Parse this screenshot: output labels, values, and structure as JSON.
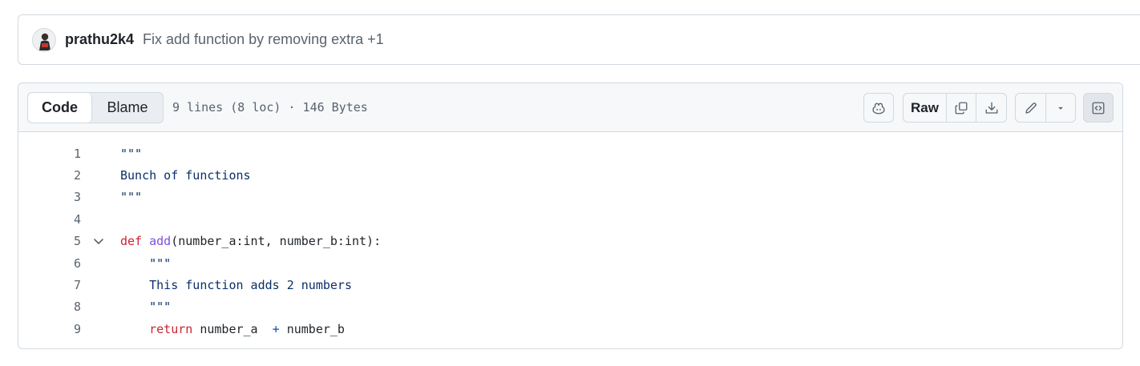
{
  "commit": {
    "author": "prathu2k4",
    "message": "Fix add function by removing extra +1"
  },
  "file_header": {
    "tabs": [
      {
        "label": "Code",
        "selected": true
      },
      {
        "label": "Blame",
        "selected": false
      }
    ],
    "meta": "9 lines (8 loc) · 146 Bytes",
    "raw_label": "Raw",
    "icons": {
      "copilot": "copilot-icon",
      "copy": "copy-icon",
      "download": "download-icon",
      "edit": "pencil-icon",
      "more": "triangle-down-icon",
      "symbols": "code-square-icon"
    }
  },
  "code": {
    "lines": [
      {
        "n": "1",
        "indent": "",
        "tokens": [
          {
            "t": "\"\"\"",
            "c": "str"
          }
        ]
      },
      {
        "n": "2",
        "indent": "",
        "tokens": [
          {
            "t": "Bunch of functions",
            "c": "str"
          }
        ]
      },
      {
        "n": "3",
        "indent": "",
        "tokens": [
          {
            "t": "\"\"\"",
            "c": "str"
          }
        ]
      },
      {
        "n": "4",
        "indent": "",
        "tokens": []
      },
      {
        "n": "5",
        "indent": "",
        "fold": true,
        "tokens": [
          {
            "t": "def",
            "c": "kw"
          },
          {
            "t": " ",
            "c": ""
          },
          {
            "t": "add",
            "c": "fn"
          },
          {
            "t": "(number_a:int, number_b:int):",
            "c": ""
          }
        ]
      },
      {
        "n": "6",
        "indent": "    ",
        "tokens": [
          {
            "t": "\"\"\"",
            "c": "str"
          }
        ]
      },
      {
        "n": "7",
        "indent": "    ",
        "tokens": [
          {
            "t": "This function adds 2 numbers",
            "c": "str"
          }
        ]
      },
      {
        "n": "8",
        "indent": "    ",
        "tokens": [
          {
            "t": "\"\"\"",
            "c": "str"
          }
        ]
      },
      {
        "n": "9",
        "indent": "    ",
        "tokens": [
          {
            "t": "return",
            "c": "kw"
          },
          {
            "t": " number_a  ",
            "c": ""
          },
          {
            "t": "+",
            "c": "op"
          },
          {
            "t": " number_b",
            "c": ""
          }
        ]
      }
    ]
  }
}
